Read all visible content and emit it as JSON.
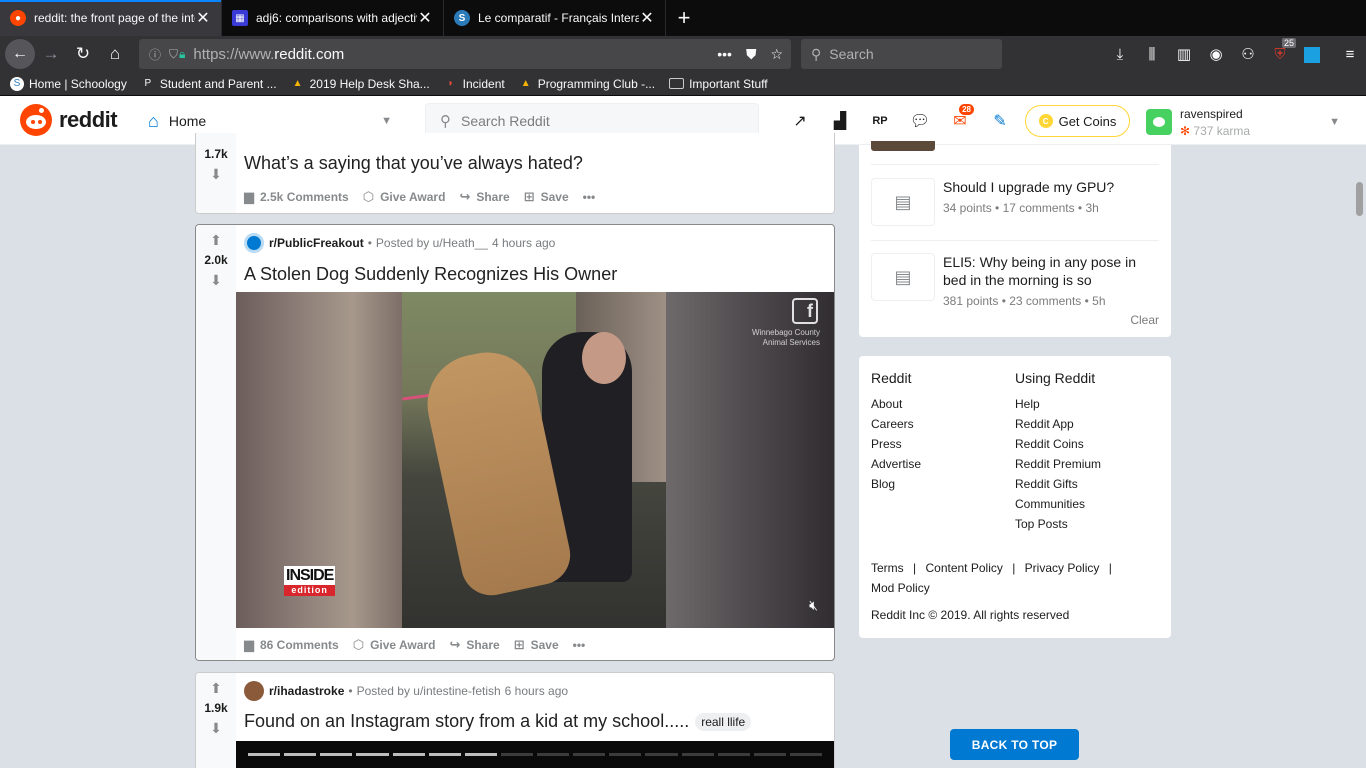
{
  "browser": {
    "tabs": [
      {
        "title": "reddit: the front page of the inte",
        "favicon": "reddit-icon",
        "active": true
      },
      {
        "title": "adj6: comparisons with adjectiv",
        "favicon": "grid-icon",
        "active": false
      },
      {
        "title": "Le comparatif - Français Interac",
        "favicon": "schoology-icon",
        "active": false
      }
    ],
    "url_prefix": "https://www.",
    "url_domain": "reddit.com",
    "search_placeholder": "Search",
    "ext_badge": "25",
    "bookmarks": [
      {
        "label": "Home | Schoology",
        "icon": "schoology-icon"
      },
      {
        "label": "Student and Parent ...",
        "icon": "p-icon"
      },
      {
        "label": "2019 Help Desk Sha...",
        "icon": "drive-icon"
      },
      {
        "label": "Incident",
        "icon": "incident-icon"
      },
      {
        "label": "Programming Club -...",
        "icon": "drive-icon"
      },
      {
        "label": "Important Stuff",
        "icon": "folder-icon"
      }
    ]
  },
  "reddit": {
    "brand": "reddit",
    "home_label": "Home",
    "search_placeholder": "Search Reddit",
    "mail_badge": "28",
    "coins_label": "Get Coins",
    "username": "ravenspired",
    "karma": "737 karma",
    "accent": "#ff4500",
    "blue": "#0079d3"
  },
  "posts": [
    {
      "score": "1.7k",
      "title": "What’s a saying that you’ve always hated?",
      "comments": "2.5k Comments",
      "give_award": "Give Award",
      "share": "Share",
      "save": "Save"
    },
    {
      "score": "2.0k",
      "subreddit": "r/PublicFreakout",
      "posted_by": "Posted by u/Heath__",
      "time": "4 hours ago",
      "title": "A Stolen Dog Suddenly Recognizes His Owner",
      "media_watermark_line1": "Winnebago County",
      "media_watermark_line2": "Animal Services",
      "media_logo_line1": "INSIDE",
      "media_logo_line2": "edition",
      "comments": "86 Comments",
      "give_award": "Give Award",
      "share": "Share",
      "save": "Save"
    },
    {
      "score": "1.9k",
      "subreddit": "r/ihadastroke",
      "posted_by": "Posted by u/intestine-fetish",
      "time": "6 hours ago",
      "title": "Found on an Instagram story from a kid at my school.....",
      "flair": "reall llife",
      "story_progress": {
        "segments_total": 16,
        "segments_viewed": 7
      }
    }
  ],
  "recent_posts": [
    {
      "title": "Should I upgrade my GPU?",
      "meta": "34 points • 17 comments • 3h"
    },
    {
      "title": "ELI5: Why being in any pose in bed in the morning is so",
      "meta": "381 points • 23 comments • 5h"
    }
  ],
  "recent_clear": "Clear",
  "footer": {
    "col1_title": "Reddit",
    "col1": [
      "About",
      "Careers",
      "Press",
      "Advertise",
      "Blog"
    ],
    "col2_title": "Using Reddit",
    "col2": [
      "Help",
      "Reddit App",
      "Reddit Coins",
      "Reddit Premium",
      "Reddit Gifts",
      "Communities",
      "Top Posts"
    ],
    "legal": [
      "Terms",
      "Content Policy",
      "Privacy Policy",
      "Mod Policy"
    ],
    "separator": "|",
    "copyright": "Reddit Inc © 2019. All rights reserved"
  },
  "back_to_top": "BACK TO TOP"
}
